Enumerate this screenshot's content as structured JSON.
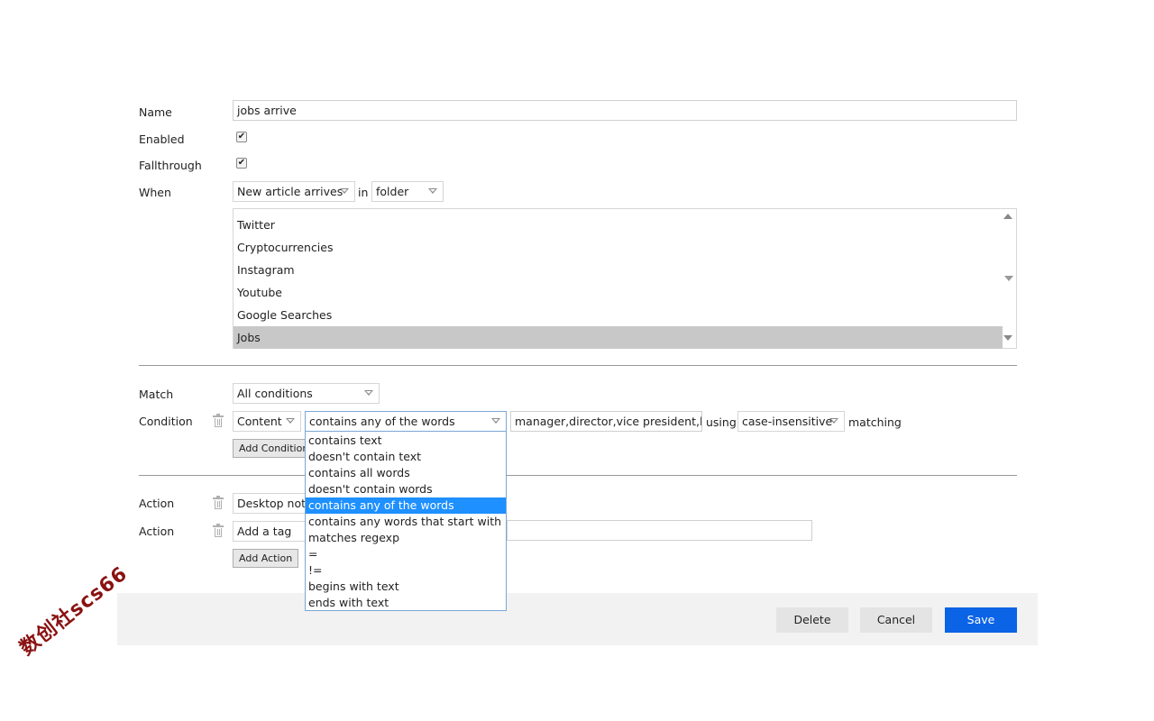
{
  "form": {
    "name_label": "Name",
    "name_value": "jobs arrive",
    "enabled_label": "Enabled",
    "enabled_checked": true,
    "fallthrough_label": "Fallthrough",
    "fallthrough_checked": true,
    "when_label": "When",
    "when_event": "New article arrives",
    "in_text": "in",
    "when_scope": "folder",
    "folders": [
      "Twitter",
      "Cryptocurrencies",
      "Instagram",
      "Youtube",
      "Google Searches",
      "Jobs"
    ],
    "selected_folder": "Jobs",
    "match_label": "Match",
    "match_value": "All conditions",
    "condition_label": "Condition",
    "condition_field": "Content",
    "condition_operator": "contains any of the words",
    "condition_value": "manager,director,vice president,leac",
    "using_text": "using",
    "condition_case": "case-insensitive",
    "matching_text": "matching",
    "add_condition_label": "Add Condition",
    "action1_label": "Action",
    "action1_value": "Desktop noti",
    "action2_label": "Action",
    "action2_value": "Add a tag",
    "add_action_label": "Add Action"
  },
  "operator_dropdown": {
    "options": [
      "contains text",
      "doesn't contain text",
      "contains all words",
      "doesn't contain words",
      "contains any of the words",
      "contains any words that start with",
      "matches regexp",
      "=",
      "!=",
      "begins with text",
      "ends with text"
    ],
    "selected": "contains any of the words"
  },
  "footer": {
    "delete_label": "Delete",
    "cancel_label": "Cancel",
    "save_label": "Save"
  },
  "watermark": "数创社scs66",
  "icons": [
    "check-icon",
    "chevron-down-icon",
    "trash-icon",
    "scroll-up-icon",
    "scroll-down-icon"
  ],
  "colors": {
    "primary": "#0b63e5",
    "selection": "#1e90ff",
    "list_selection": "#c8c8c8"
  }
}
